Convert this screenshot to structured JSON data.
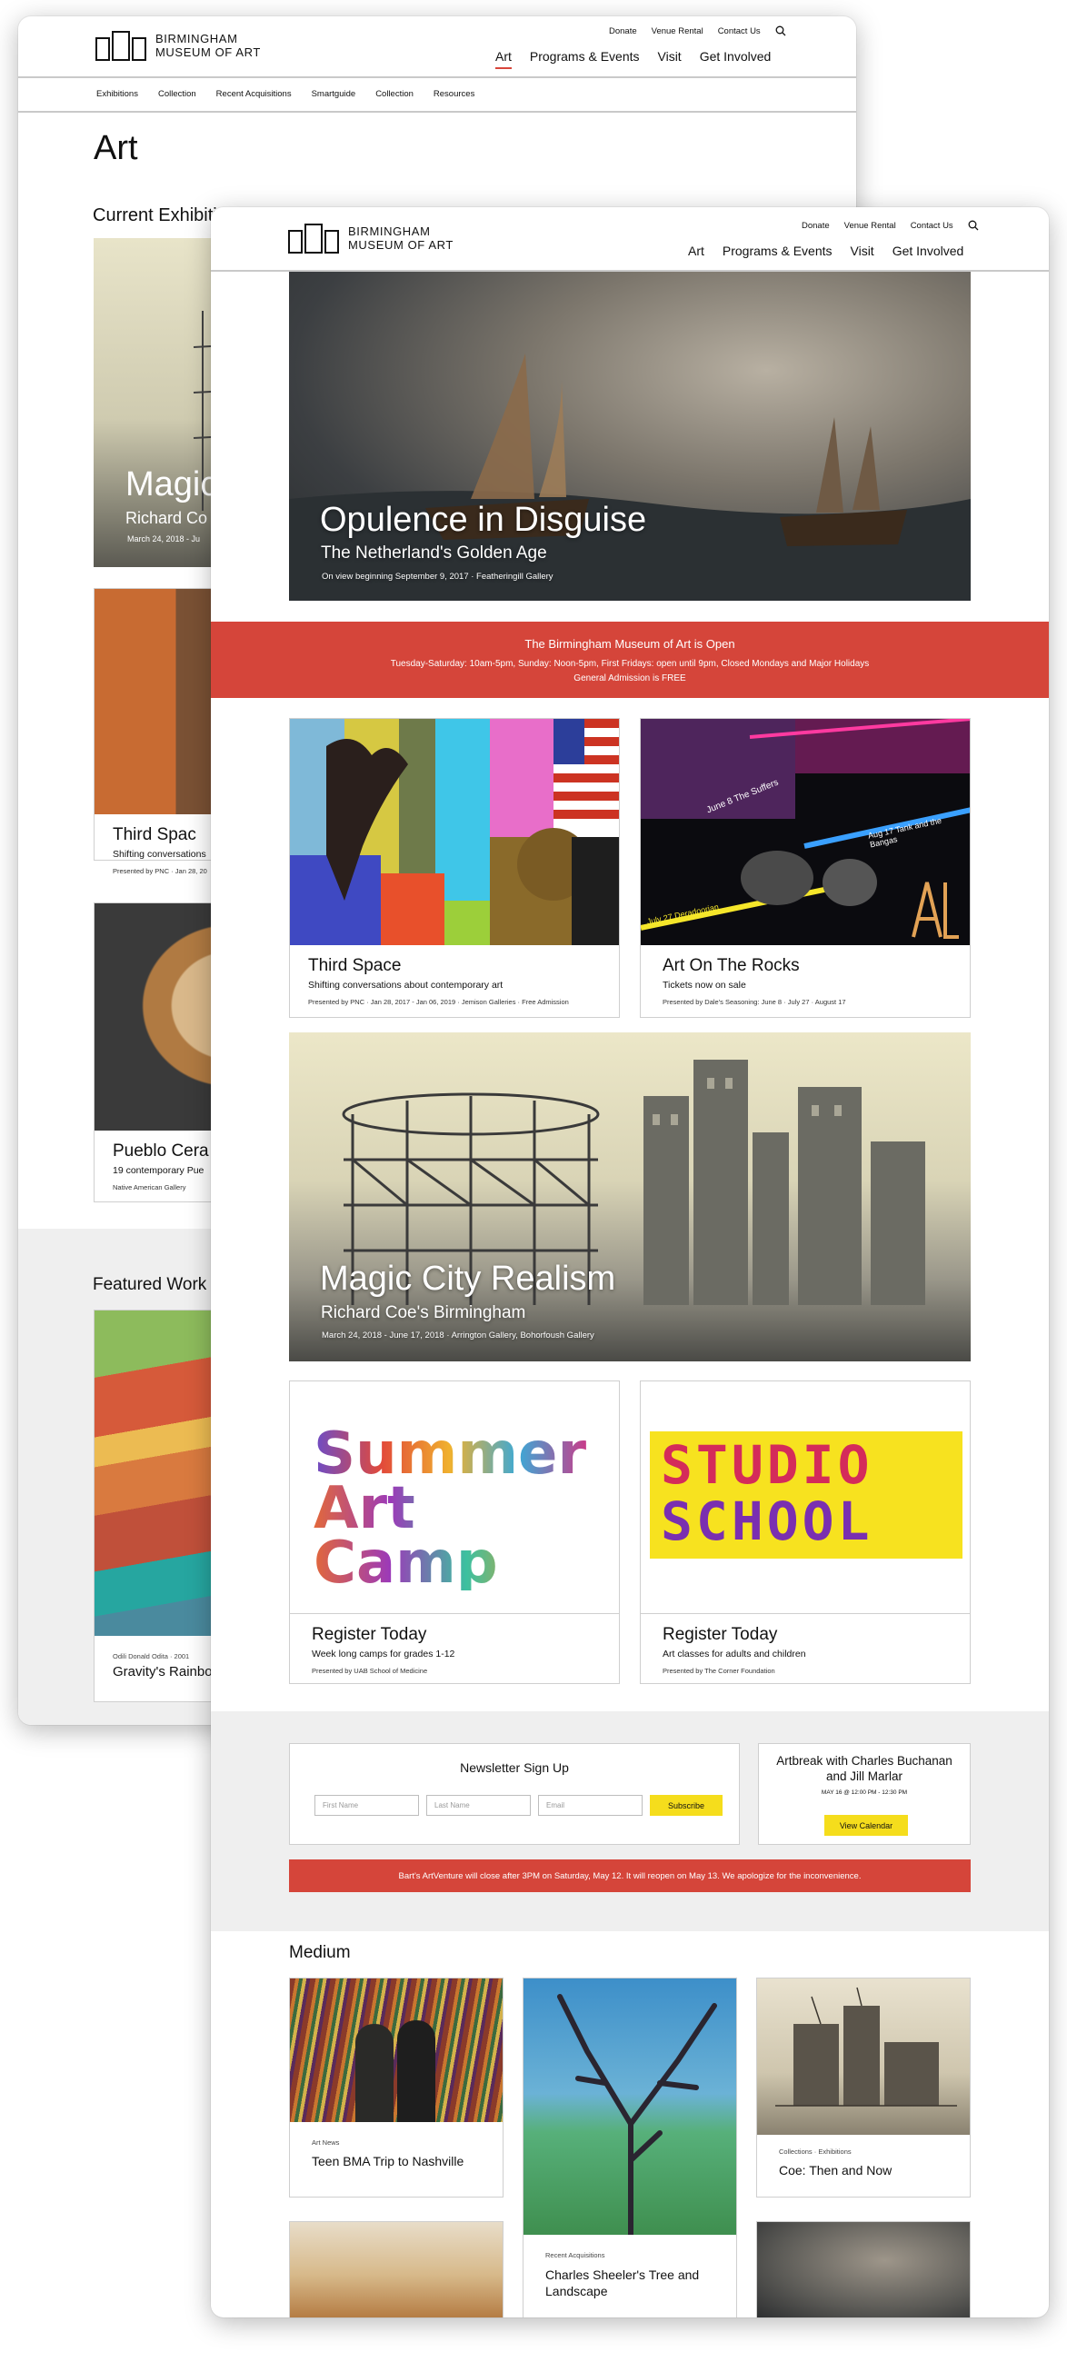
{
  "brand": {
    "name_line1": "BIRMINGHAM",
    "name_line2": "MUSEUM OF ART"
  },
  "utility_nav": [
    "Donate",
    "Venue Rental",
    "Contact Us"
  ],
  "main_nav": [
    "Art",
    "Programs & Events",
    "Visit",
    "Get Involved"
  ],
  "back_page": {
    "sub_nav": [
      "Exhibitions",
      "Collection",
      "Recent Acquisitions",
      "Smartguide",
      "Collection",
      "Resources"
    ],
    "page_title": "Art",
    "current_heading": "Current Exhibiti",
    "card_magic": {
      "title": "Magic",
      "sub": "Richard Co",
      "meta": "March 24, 2018 - Ju"
    },
    "card_third": {
      "title": "Third Spac",
      "sub": "Shifting conversations",
      "meta": "Presented by PNC  ·  Jan 28, 20"
    },
    "card_pueblo": {
      "title": "Pueblo Cera",
      "sub": "19 contemporary Pue",
      "meta": "Native American Gallery"
    },
    "featured_heading": "Featured Work",
    "card_gravity": {
      "meta": "Odili Donald Odita  ·  2001",
      "title": "Gravity's Rainbo"
    }
  },
  "hero": {
    "title": "Opulence in Disguise",
    "subtitle": "The Netherland's Golden Age",
    "meta": "On view beginning September 9, 2017  ·  Featheringill Gallery"
  },
  "open_banner": {
    "title": "The Birmingham Museum of Art is Open",
    "line1": "Tuesday-Saturday: 10am-5pm, Sunday: Noon-5pm, First Fridays: open until 9pm, Closed Mondays and Major Holidays",
    "line2": "General Admission is FREE"
  },
  "cards": {
    "third_space": {
      "title": "Third Space",
      "sub": "Shifting conversations about contemporary art",
      "meta": "Presented by PNC  ·  Jan 28, 2017 - Jan 06, 2019  ·  Jemison Galleries  ·  Free Admission"
    },
    "art_on_rocks": {
      "title": "Art On The Rocks",
      "sub": "Tickets now on sale",
      "meta": "Presented by Dale's Seasoning: June 8  ·  July 27  ·  August 17",
      "poster": {
        "l1": "June 8  The Suffers",
        "l2": "Aug 17  Tank and the Bangas",
        "l3": "July 27  Deradoorian",
        "mark": "ArT"
      }
    },
    "summer_camp": {
      "art_line1": "Summer",
      "art_line2": "Art Camp",
      "title": "Register Today",
      "sub": "Week long camps for grades 1-12",
      "meta": "Presented by UAB School of Medicine"
    },
    "studio_school": {
      "art_line1": "STUDIO",
      "art_line2": "SCHOOL",
      "title": "Register Today",
      "sub": "Art classes for adults and children",
      "meta": "Presented by The Corner Foundation"
    }
  },
  "magic_hero": {
    "title": "Magic City Realism",
    "subtitle": "Richard Coe's Birmingham",
    "meta": "March 24, 2018 - June 17, 2018  ·  Arrington Gallery, Bohorfoush Gallery"
  },
  "newsletter": {
    "heading": "Newsletter Sign Up",
    "first_placeholder": "First Name",
    "last_placeholder": "Last Name",
    "email_placeholder": "Email",
    "subscribe_label": "Subscribe"
  },
  "artbreak": {
    "title": "Artbreak with Charles Buchanan and Jill Marlar",
    "date": "MAY 16 @ 12:00 PM - 12:30 PM",
    "button": "View Calendar"
  },
  "closure_banner": "Bart's ArtVenture will close after 3PM on Saturday, May 12. It will reopen on May 13. We apologize for the inconvenience.",
  "medium": {
    "heading": "Medium",
    "items": [
      {
        "tag": "Art News",
        "title": "Teen BMA Trip to Nashville"
      },
      {
        "tag": "Recent Acquisitions",
        "title": "Charles Sheeler's Tree and Landscape"
      },
      {
        "tag": "Collections  ·  Exhibitions",
        "title": "Coe: Then and Now"
      }
    ]
  },
  "colors": {
    "accent_red": "#d5453a",
    "button_yellow": "#f5dd1c",
    "footer_gray": "#efefef"
  },
  "icons": [
    "search-icon",
    "logo-mark"
  ]
}
